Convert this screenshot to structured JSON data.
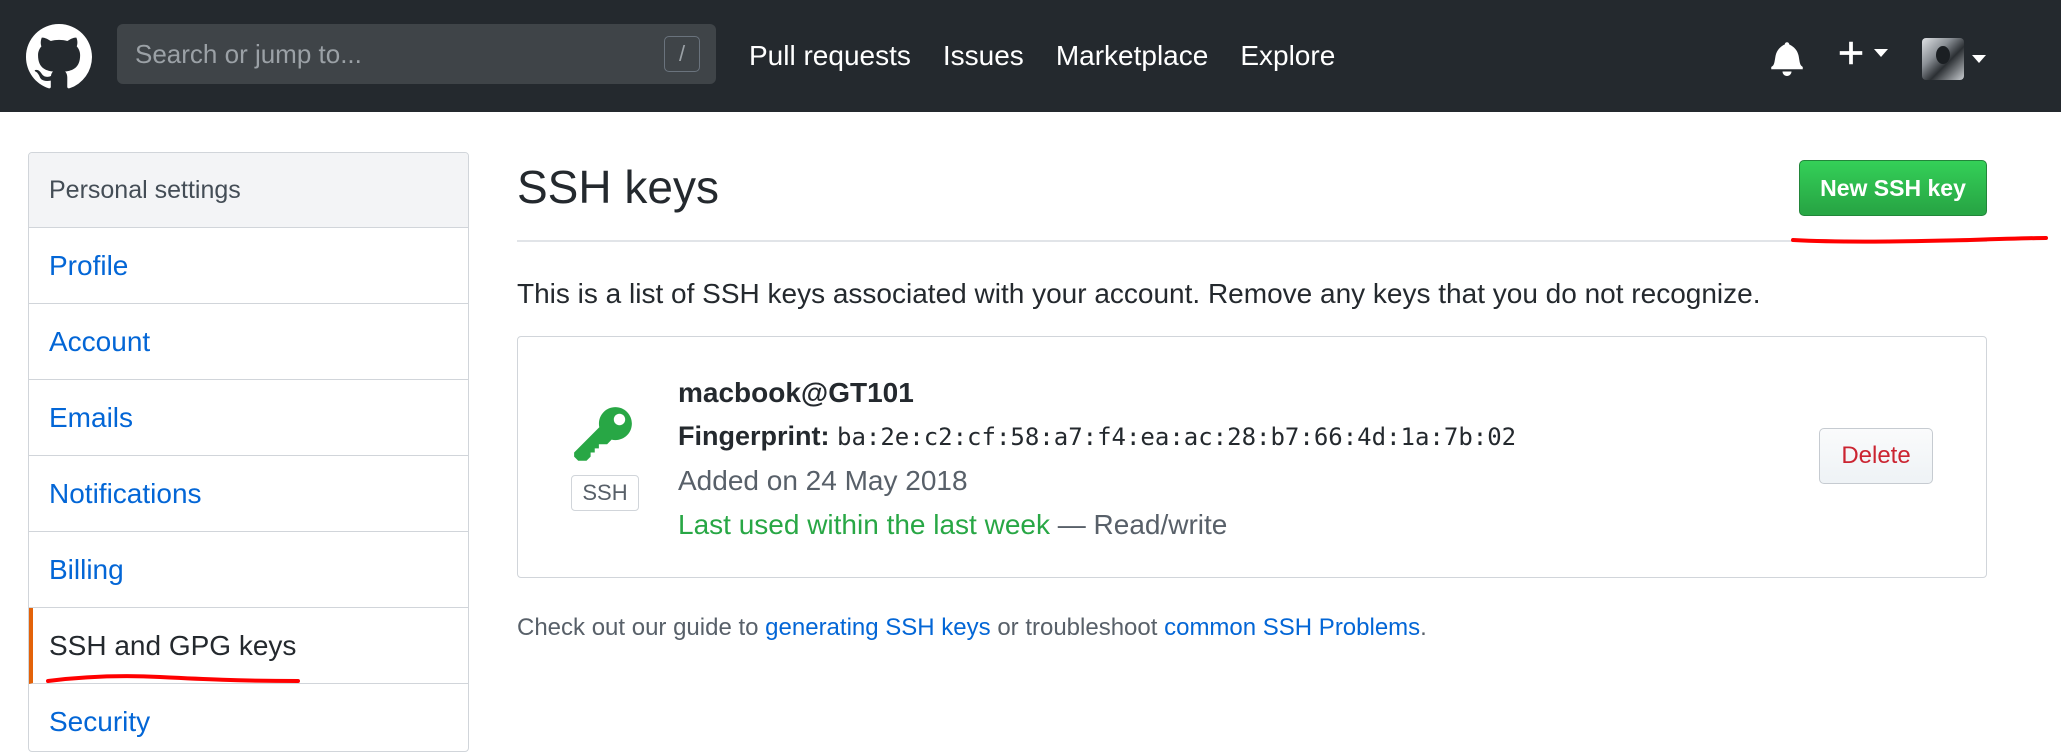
{
  "header": {
    "search": {
      "placeholder": "Search or jump to...",
      "shortcut": "/"
    },
    "nav": [
      "Pull requests",
      "Issues",
      "Marketplace",
      "Explore"
    ],
    "icons": [
      "github-logo",
      "bell-icon",
      "plus-icon",
      "avatar"
    ]
  },
  "sidebar": {
    "title": "Personal settings",
    "items": [
      {
        "label": "Profile"
      },
      {
        "label": "Account"
      },
      {
        "label": "Emails"
      },
      {
        "label": "Notifications"
      },
      {
        "label": "Billing"
      },
      {
        "label": "SSH and GPG keys",
        "active": true
      },
      {
        "label": "Security"
      }
    ]
  },
  "main": {
    "title": "SSH keys",
    "new_key_button": "New SSH key",
    "intro": "This is a list of SSH keys associated with your account. Remove any keys that you do not recognize.",
    "key": {
      "name": "macbook@GT101",
      "fingerprint_label": "Fingerprint:",
      "fingerprint": "ba:2e:c2:cf:58:a7:f4:ea:ac:28:b7:66:4d:1a:7b:02",
      "type_label": "SSH",
      "added": "Added on 24 May 2018",
      "last_used": "Last used within the last week",
      "separator": "—",
      "access": "Read/write",
      "delete_button": "Delete"
    },
    "footer": {
      "prefix": "Check out our guide to",
      "link1": "generating SSH keys",
      "middle": "or troubleshoot",
      "link2": "common SSH Problems",
      "suffix": "."
    }
  },
  "colors": {
    "header_bg": "#24292e",
    "link": "#0366d6",
    "primary_button": "#28a745",
    "danger": "#cb2431",
    "active_indicator": "#e36209",
    "annotation": "#ff0000"
  }
}
